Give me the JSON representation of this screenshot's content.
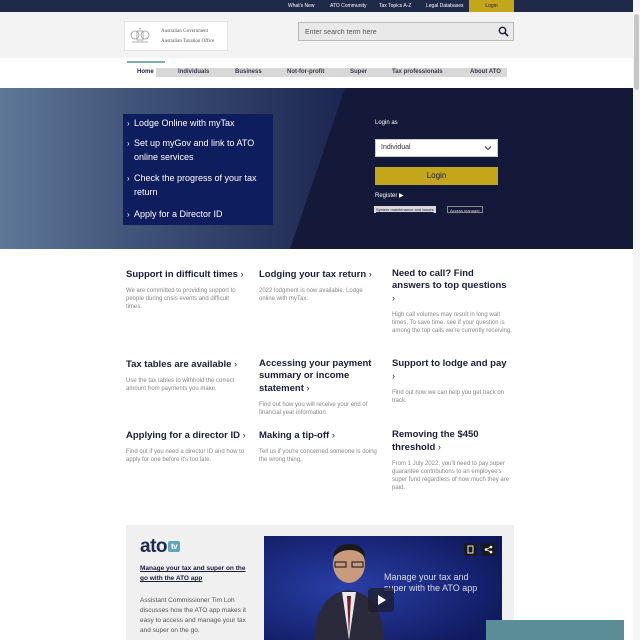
{
  "utility_nav": [
    {
      "label": "What's New"
    },
    {
      "label": "ATO Community"
    },
    {
      "label": "Tax Topics A-Z"
    },
    {
      "label": "Legal Databases"
    }
  ],
  "utility_login": "Login",
  "logo": {
    "line1": "Australian Government",
    "line2": "Australian Taxation Office"
  },
  "search": {
    "placeholder": "Enter search term here",
    "icon": "search-icon"
  },
  "main_nav": [
    {
      "label": "Home",
      "active": true
    },
    {
      "label": "Individuals"
    },
    {
      "label": "Business"
    },
    {
      "label": "Not-for-profit"
    },
    {
      "label": "Super"
    },
    {
      "label": "Tax professionals"
    },
    {
      "label": "About ATO"
    }
  ],
  "hero": {
    "links": [
      {
        "label": "Lodge Online with myTax"
      },
      {
        "label": "Set up myGov and link to ATO online services"
      },
      {
        "label": "Check the progress of your tax return"
      },
      {
        "label": "Apply for a Director ID"
      }
    ],
    "login_as_label": "Login as",
    "login_as_value": "Individual",
    "login_button": "Login",
    "register": "Register",
    "system_maintenance": "System maintenance and issues",
    "access_manager": "Access manager"
  },
  "cards": [
    {
      "title": "Support in difficult times",
      "desc": "We are committed to providing support to people during crisis events and difficult times."
    },
    {
      "title": "Lodging your tax return",
      "desc": "2022 lodgment is now available. Lodge online with myTax."
    },
    {
      "title": "Need to call? Find answers to top questions",
      "desc": "High call volumes may result in long wait times. To save time, see if your question is among the top calls we're currently receiving."
    },
    {
      "title": "Tax tables are available",
      "desc": "Use the tax tables to withhold the correct amount from payments you make."
    },
    {
      "title": "Accessing your payment summary or income statement",
      "desc": "Find out how you will receive your end of financial year information."
    },
    {
      "title": "Support to lodge and pay",
      "desc": "Find out how we can help you get back on track."
    },
    {
      "title": "Applying for a director ID",
      "desc": "Find out if you need a director ID and how to apply for one before it's too late."
    },
    {
      "title": "Making a tip-off",
      "desc": "Tell us if you're concerned someone is doing the wrong thing."
    },
    {
      "title": "Removing the $450 threshold",
      "desc": "From 1 July 2022, you'll need to pay super guarantee contributions to an employee's super fund regardless of how much they are paid."
    }
  ],
  "video": {
    "brand": "ato",
    "brand_tv": "tv",
    "title": "Manage your tax and super on the go with the ATO app",
    "desc": "Assistant Commissioner Tim Loh discusses how the ATO app makes it easy to access and manage your tax and super on the go.",
    "caption": "Manage your tax and super with the ATO app"
  },
  "colors": {
    "navy": "#1f2a4a",
    "gold": "#c3a619",
    "hero_dark": "#14193a",
    "hero_panel": "#0e1d5e",
    "teal": "#5a8d95"
  }
}
